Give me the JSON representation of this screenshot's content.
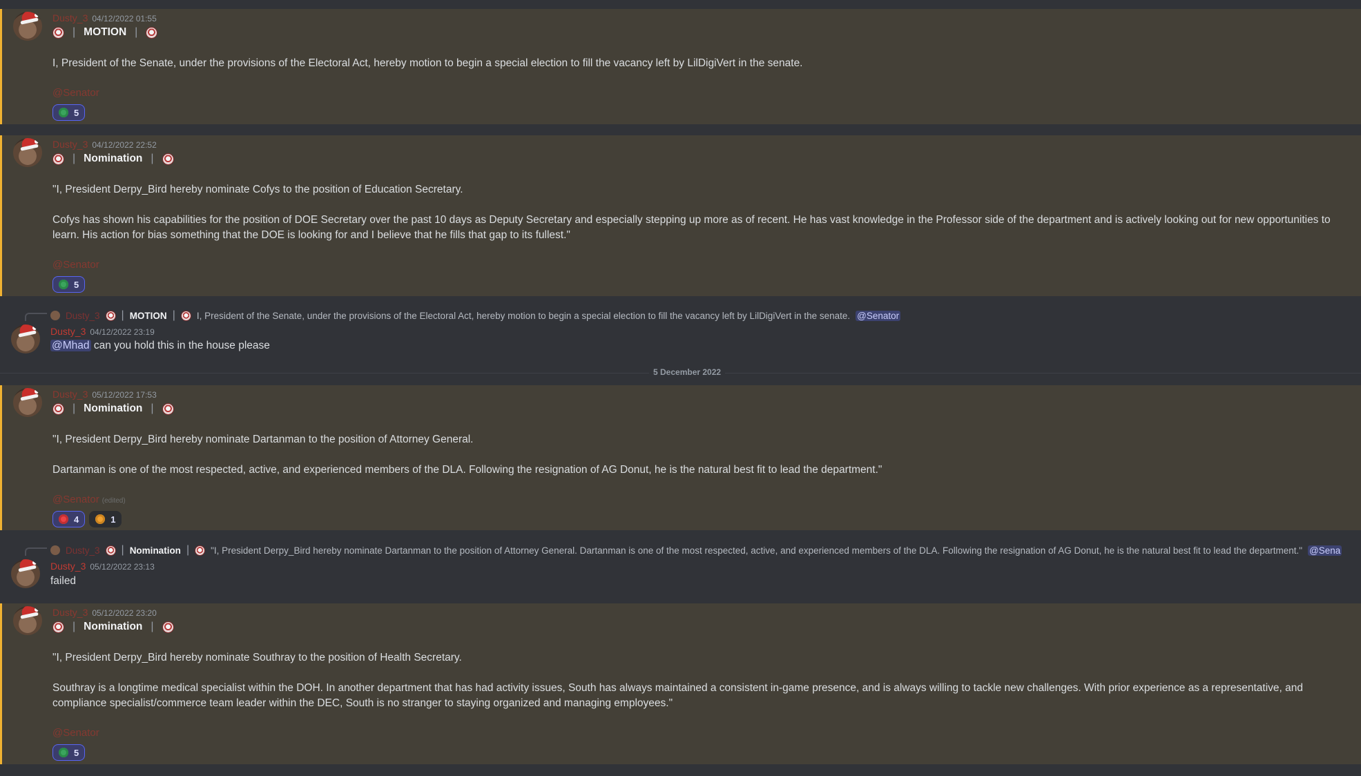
{
  "messages": [
    {
      "author": "Dusty_3",
      "time": "04/12/2022 01:55",
      "title": "MOTION",
      "body": "I, President of the Senate, under the provisions of the Electoral Act, hereby motion to begin a special election to fill the vacancy left by LilDigiVert in the senate.",
      "role_mention": "@Senator",
      "reactions": [
        {
          "icon": "aye-emoji",
          "count": "5"
        }
      ]
    },
    {
      "author": "Dusty_3",
      "time": "04/12/2022 22:52",
      "title": "Nomination",
      "para1": "\"I, President Derpy_Bird hereby nominate Cofys to the position of Education Secretary.",
      "para2": "Cofys has shown his capabilities for the position of DOE Secretary over the past 10 days as Deputy Secretary and especially stepping up more as of recent. He has vast knowledge in the Professor side of the department and is actively looking out for new opportunities to learn. His action for bias something that the DOE is looking for and I believe that he fills that gap to its fullest.\"",
      "role_mention": "@Senator",
      "reactions": [
        {
          "icon": "aye-emoji",
          "count": "5"
        }
      ]
    },
    {
      "reply_author": "Dusty_3",
      "reply_title": "MOTION",
      "reply_text": "I, President of the Senate, under the provisions of the Electoral Act, hereby motion to begin a special election to fill the vacancy left by LilDigiVert in the senate.",
      "reply_mention": "@Senator",
      "author": "Dusty_3",
      "time": "04/12/2022 23:19",
      "mention": "@Mhad",
      "text": "can you hold this in the house please"
    },
    {
      "author": "Dusty_3",
      "time": "05/12/2022 17:53",
      "title": "Nomination",
      "para1": "\"I, President Derpy_Bird hereby nominate Dartanman to the position of Attorney General.",
      "para2": "Dartanman is one of the most respected, active, and experienced members of the DLA. Following the resignation of AG Donut, he is the natural best fit to lead the department.\"",
      "role_mention": "@Senator",
      "edited": "(edited)",
      "reactions": [
        {
          "icon": "nay-emoji",
          "count": "4"
        },
        {
          "icon": "abstain-emoji",
          "count": "1"
        }
      ]
    },
    {
      "reply_author": "Dusty_3",
      "reply_title": "Nomination",
      "reply_text": "\"I, President Derpy_Bird hereby nominate Dartanman to the position of Attorney General.  Dartanman is one of the most respected, active, and experienced members of the DLA. Following the resignation of AG Donut, he is the natural best fit to lead the department.\"",
      "reply_mention": "@Sena",
      "author": "Dusty_3",
      "time": "05/12/2022 23:13",
      "text": "failed"
    },
    {
      "author": "Dusty_3",
      "time": "05/12/2022 23:20",
      "title": "Nomination",
      "para1": "\"I, President Derpy_Bird hereby nominate Southray to the position of Health Secretary.",
      "para2": "Southray is a longtime medical specialist within the DOH. In another department that has had activity issues, South has always maintained a consistent in-game presence, and is always willing to tackle new challenges. With prior experience as a representative, and compliance specialist/commerce team leader within the DEC, South is no stranger to staying organized and managing employees.\"",
      "role_mention": "@Senator",
      "reactions": [
        {
          "icon": "aye-emoji",
          "count": "5"
        }
      ]
    }
  ],
  "date_divider": "5 December 2022"
}
